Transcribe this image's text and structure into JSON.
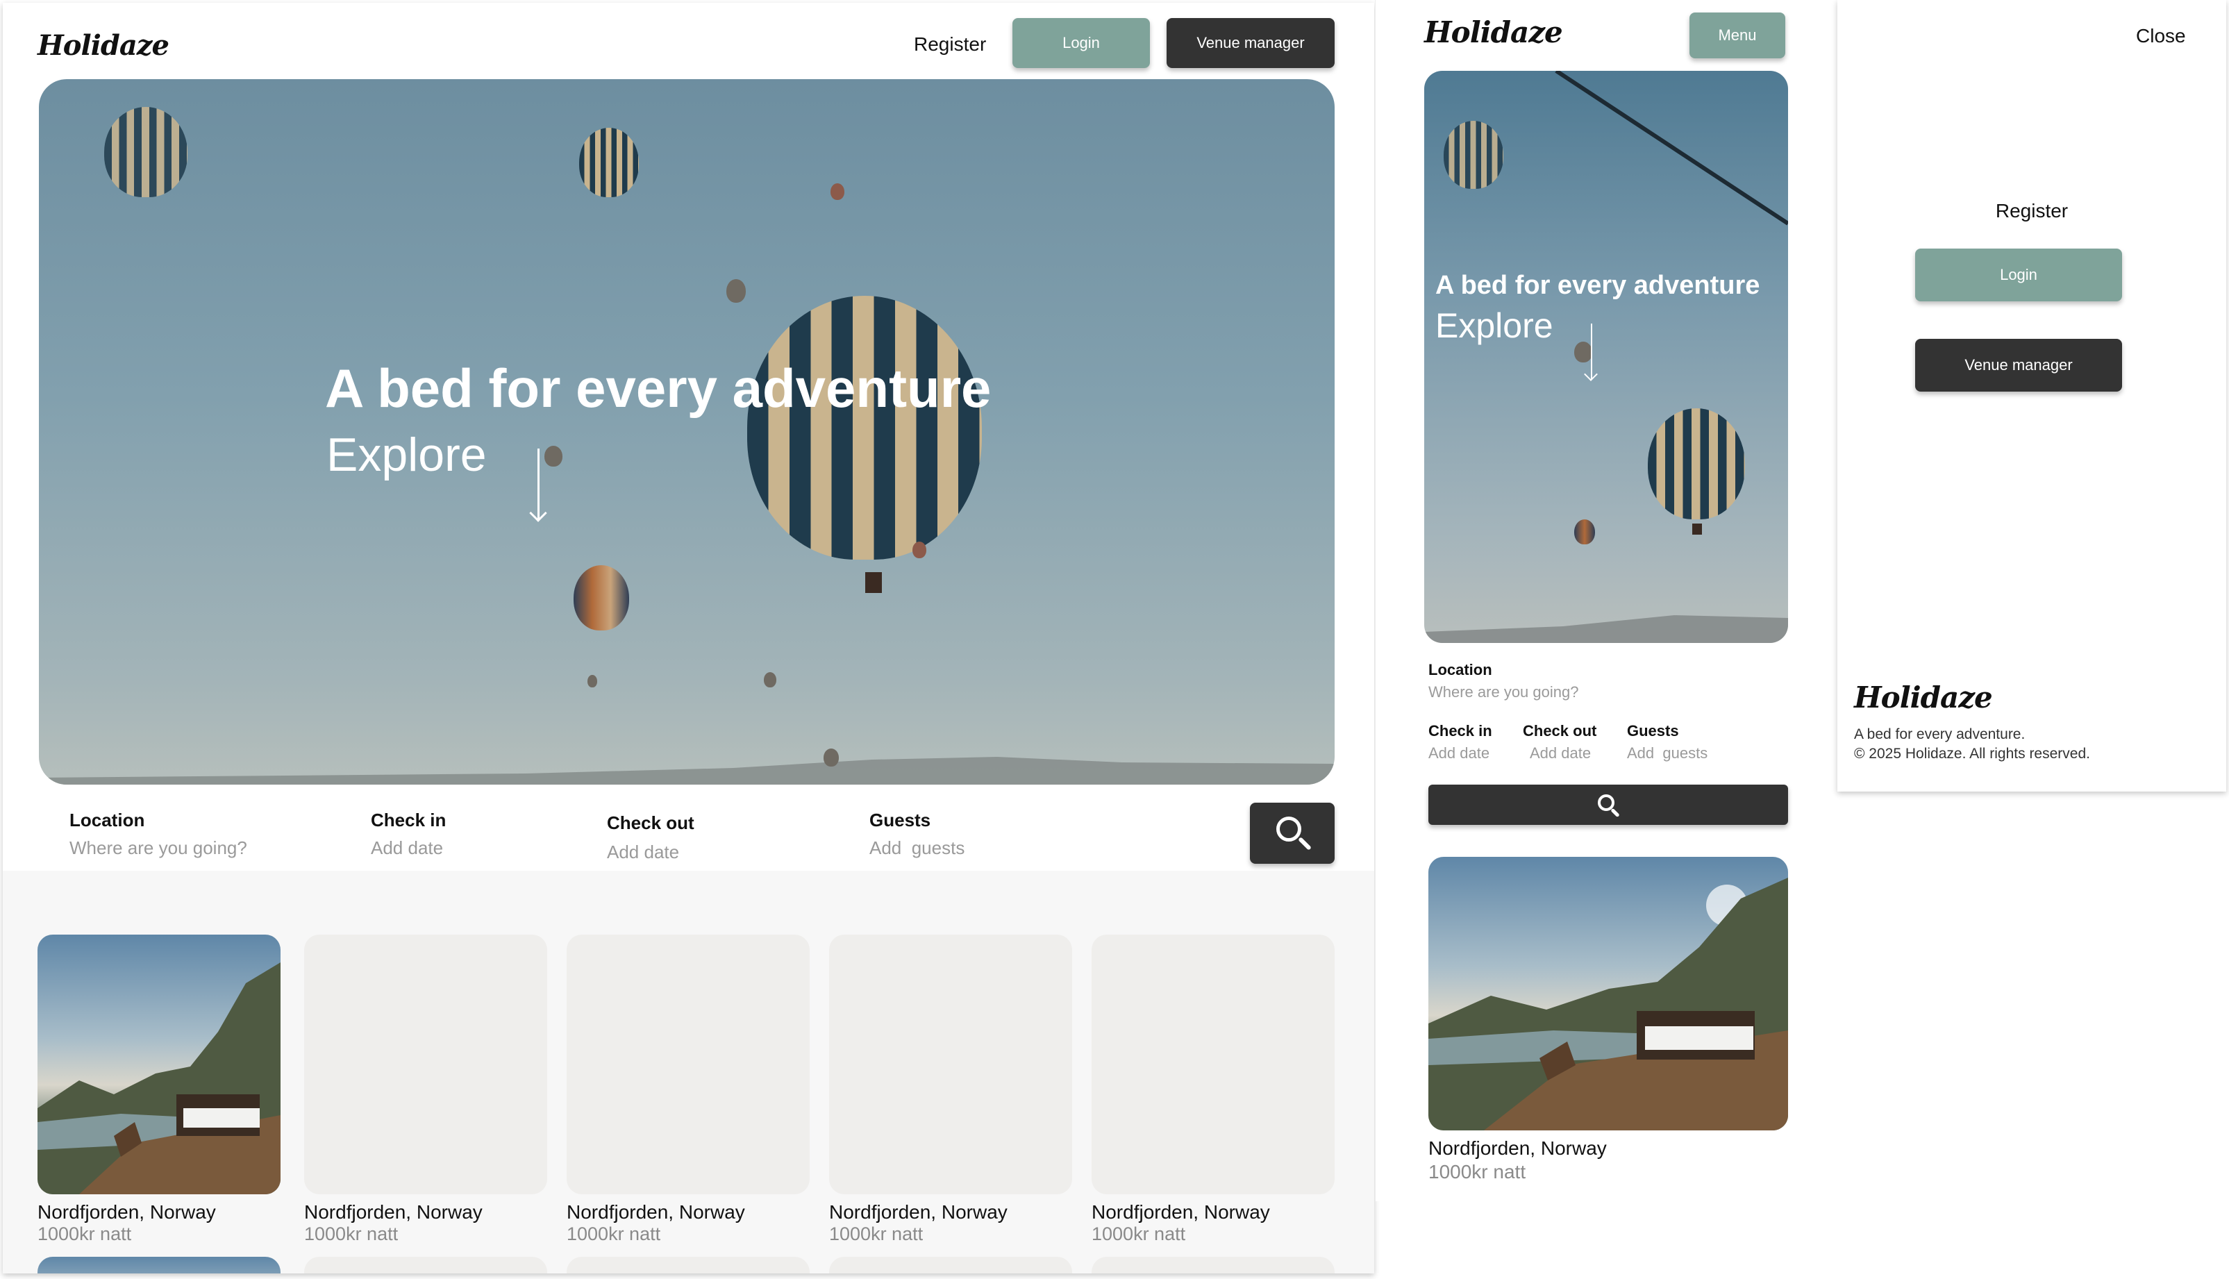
{
  "brand": "Holidaze",
  "nav": {
    "register": "Register",
    "login": "Login",
    "venue_manager": "Venue manager",
    "menu": "Menu",
    "close": "Close"
  },
  "hero": {
    "title": "A bed for every adventure",
    "subtitle": "Explore"
  },
  "search": {
    "location_label": "Location",
    "location_placeholder": "Where are you going?",
    "checkin_label": "Check in",
    "checkin_placeholder": "Add date",
    "checkout_label": "Check out",
    "checkout_placeholder": "Add date",
    "guests_label": "Guests",
    "guests_placeholder": "Add  guests"
  },
  "listings": [
    {
      "title": "Nordfjorden, Norway",
      "price": "1000kr natt"
    },
    {
      "title": "Nordfjorden, Norway",
      "price": "1000kr natt"
    },
    {
      "title": "Nordfjorden, Norway",
      "price": "1000kr natt"
    },
    {
      "title": "Nordfjorden, Norway",
      "price": "1000kr natt"
    },
    {
      "title": "Nordfjorden, Norway",
      "price": "1000kr natt"
    }
  ],
  "mobile_listing": {
    "title": "Nordfjorden, Norway",
    "price": "1000kr natt"
  },
  "footer": {
    "brand": "Holidaze",
    "tagline": "A bed for every adventure.",
    "copyright": "© 2025 Holidaze. All rights reserved."
  },
  "colors": {
    "accent_green": "#7fa39a",
    "dark": "#333333"
  },
  "icons": [
    "search-icon",
    "arrow-down-icon"
  ]
}
